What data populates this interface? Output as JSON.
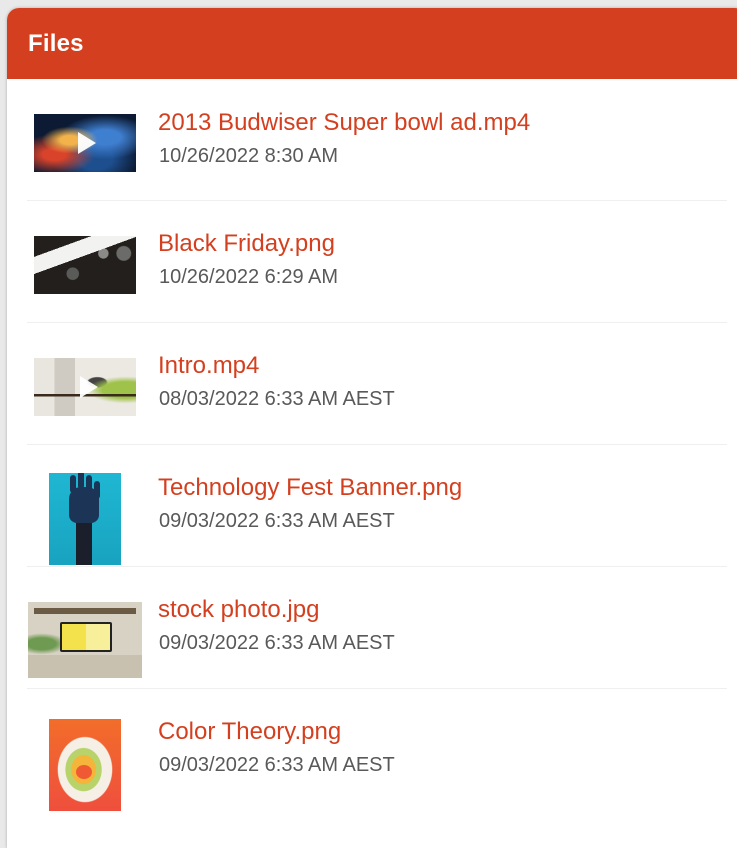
{
  "header": {
    "title": "Files"
  },
  "colors": {
    "accent": "#d4401f",
    "date_text": "#595959"
  },
  "files": [
    {
      "name": "2013 Budwiser Super bowl ad.mp4",
      "date": "10/26/2022 8:30 AM",
      "type": "video"
    },
    {
      "name": "Black Friday.png",
      "date": "10/26/2022 6:29 AM",
      "type": "image"
    },
    {
      "name": "Intro.mp4",
      "date": "08/03/2022 6:33 AM AEST",
      "type": "video"
    },
    {
      "name": "Technology Fest Banner.png",
      "date": "09/03/2022 6:33 AM AEST",
      "type": "image"
    },
    {
      "name": "stock photo.jpg",
      "date": "09/03/2022 6:33 AM AEST",
      "type": "image"
    },
    {
      "name": "Color Theory.png",
      "date": "09/03/2022 6:33 AM AEST",
      "type": "image"
    }
  ]
}
